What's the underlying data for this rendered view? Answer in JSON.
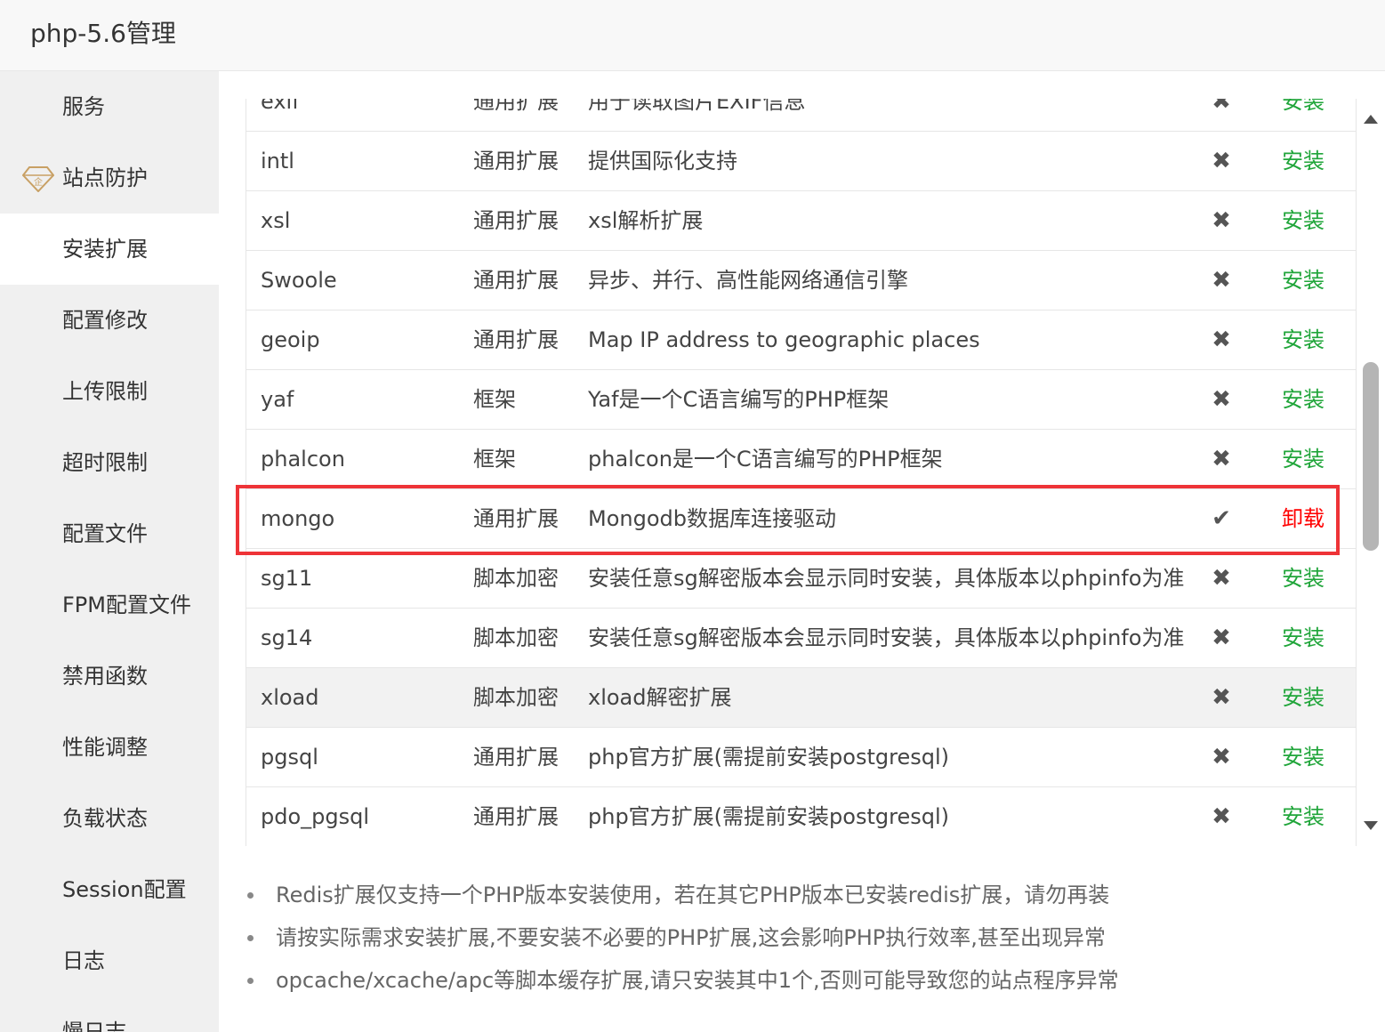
{
  "window": {
    "title": "php-5.6管理"
  },
  "sidebar": {
    "items": [
      {
        "label": "服务"
      },
      {
        "label": "站点防护",
        "icon": "vip-diamond-icon"
      },
      {
        "label": "安装扩展",
        "active": true
      },
      {
        "label": "配置修改"
      },
      {
        "label": "上传限制"
      },
      {
        "label": "超时限制"
      },
      {
        "label": "配置文件"
      },
      {
        "label": "FPM配置文件"
      },
      {
        "label": "禁用函数"
      },
      {
        "label": "性能调整"
      },
      {
        "label": "负载状态"
      },
      {
        "label": "Session配置"
      },
      {
        "label": "日志"
      },
      {
        "label": "慢日志"
      }
    ]
  },
  "extensions": {
    "rows": [
      {
        "name": "exif",
        "type": "通用扩展",
        "desc": "用于读取图片EXIF信息",
        "status": "✖",
        "action": "安装"
      },
      {
        "name": "intl",
        "type": "通用扩展",
        "desc": "提供国际化支持",
        "status": "✖",
        "action": "安装"
      },
      {
        "name": "xsl",
        "type": "通用扩展",
        "desc": "xsl解析扩展",
        "status": "✖",
        "action": "安装"
      },
      {
        "name": "Swoole",
        "type": "通用扩展",
        "desc": "异步、并行、高性能网络通信引擎",
        "status": "✖",
        "action": "安装"
      },
      {
        "name": "geoip",
        "type": "通用扩展",
        "desc": "Map IP address to geographic places",
        "status": "✖",
        "action": "安装"
      },
      {
        "name": "yaf",
        "type": "框架",
        "desc": "Yaf是一个C语言编写的PHP框架",
        "status": "✖",
        "action": "安装"
      },
      {
        "name": "phalcon",
        "type": "框架",
        "desc": "phalcon是一个C语言编写的PHP框架",
        "status": "✖",
        "action": "安装"
      },
      {
        "name": "mongo",
        "type": "通用扩展",
        "desc": "Mongodb数据库连接驱动",
        "status": "✔",
        "action": "卸载"
      },
      {
        "name": "sg11",
        "type": "脚本加密",
        "desc": "安装任意sg解密版本会显示同时安装，具体版本以phpinfo为准",
        "status": "✖",
        "action": "安装"
      },
      {
        "name": "sg14",
        "type": "脚本加密",
        "desc": "安装任意sg解密版本会显示同时安装，具体版本以phpinfo为准",
        "status": "✖",
        "action": "安装"
      },
      {
        "name": "xload",
        "type": "脚本加密",
        "desc": "xload解密扩展",
        "status": "✖",
        "action": "安装"
      },
      {
        "name": "pgsql",
        "type": "通用扩展",
        "desc": "php官方扩展(需提前安装postgresql)",
        "status": "✖",
        "action": "安装"
      },
      {
        "name": "pdo_pgsql",
        "type": "通用扩展",
        "desc": "php官方扩展(需提前安装postgresql)",
        "status": "✖",
        "action": "安装"
      }
    ]
  },
  "notes": [
    "Redis扩展仅支持一个PHP版本安装使用，若在其它PHP版本已安装redis扩展，请勿再装",
    "请按实际需求安装扩展,不要安装不必要的PHP扩展,这会影响PHP执行效率,甚至出现异常",
    "opcache/xcache/apc等脚本缓存扩展,请只安装其中1个,否则可能导致您的站点程序异常"
  ],
  "colors": {
    "install": "#20a53a",
    "uninstall": "#ff0000",
    "highlight": "#ee3337"
  }
}
